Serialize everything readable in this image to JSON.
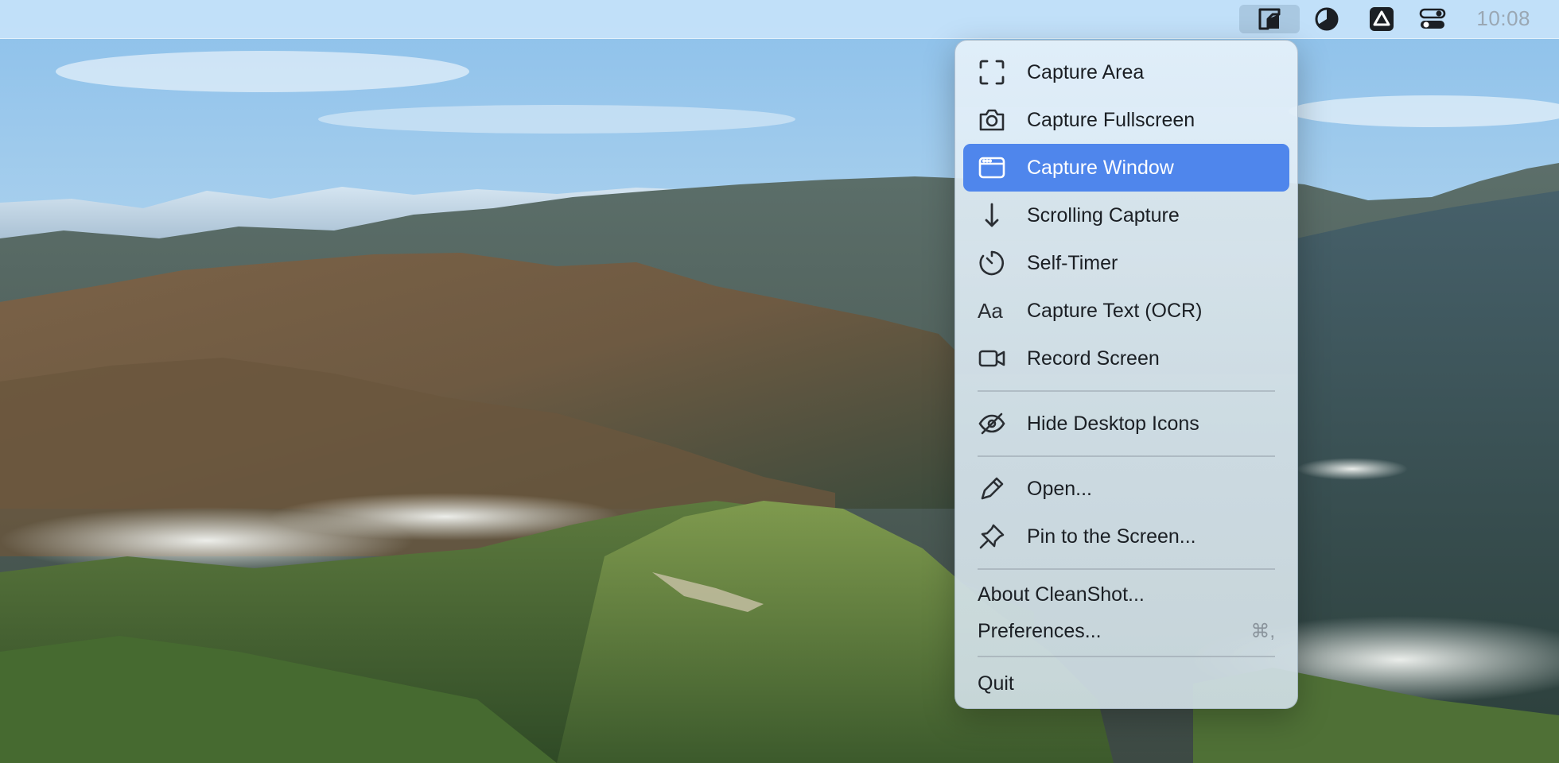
{
  "menubar": {
    "clock": "10:08",
    "status_icons": [
      "cleanshot-icon",
      "pie-timer-icon",
      "drive-icon",
      "control-center-icon"
    ]
  },
  "menu": {
    "items": [
      {
        "label": "Capture Area",
        "icon": "capture-area-icon"
      },
      {
        "label": "Capture Fullscreen",
        "icon": "camera-icon"
      },
      {
        "label": "Capture Window",
        "icon": "window-icon",
        "selected": true
      },
      {
        "label": "Scrolling Capture",
        "icon": "arrow-down-icon"
      },
      {
        "label": "Self-Timer",
        "icon": "timer-icon"
      },
      {
        "label": "Capture Text (OCR)",
        "icon": "text-aa-icon",
        "glyph": "Aa"
      },
      {
        "label": "Record Screen",
        "icon": "video-camera-icon"
      },
      {
        "label": "Hide Desktop Icons",
        "icon": "eye-slash-icon"
      },
      {
        "label": "Open...",
        "icon": "pen-icon"
      },
      {
        "label": "Pin to the Screen...",
        "icon": "pin-icon"
      },
      {
        "label": "About CleanShot..."
      },
      {
        "label": "Preferences...",
        "shortcut": "⌘,"
      },
      {
        "label": "Quit"
      }
    ]
  },
  "colors": {
    "selection": "#4f86ec",
    "menubar": "#c8e4fa"
  }
}
